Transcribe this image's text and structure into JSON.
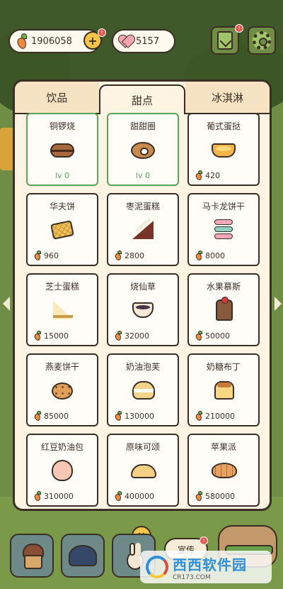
{
  "top_bar": {
    "carrots": "1906058",
    "carrot_badge": "!",
    "hearts": "5157",
    "ledger_badge": "!"
  },
  "tabs": [
    {
      "label": "饮品",
      "active": false
    },
    {
      "label": "甜点",
      "active": true
    },
    {
      "label": "冰淇淋",
      "active": false
    }
  ],
  "items": [
    {
      "name": "铜锣烧",
      "price": "",
      "level": "lv 0",
      "owned": true,
      "icon": "dorayaki-icon"
    },
    {
      "name": "甜甜圈",
      "price": "",
      "level": "lv 0",
      "owned": true,
      "icon": "donut-icon"
    },
    {
      "name": "葡式蛋挞",
      "price": "420",
      "level": "",
      "owned": false,
      "icon": "egg-tart-icon"
    },
    {
      "name": "华夫饼",
      "price": "960",
      "level": "",
      "owned": false,
      "icon": "waffle-icon"
    },
    {
      "name": "枣泥蛋糕",
      "price": "2800",
      "level": "",
      "owned": false,
      "icon": "date-cake-icon"
    },
    {
      "name": "马卡龙饼干",
      "price": "8000",
      "level": "",
      "owned": false,
      "icon": "macaron-icon"
    },
    {
      "name": "芝士蛋糕",
      "price": "15000",
      "level": "",
      "owned": false,
      "icon": "cheesecake-icon"
    },
    {
      "name": "烧仙草",
      "price": "32000",
      "level": "",
      "owned": false,
      "icon": "grass-jelly-icon"
    },
    {
      "name": "水果慕斯",
      "price": "50000",
      "level": "",
      "owned": false,
      "icon": "fruit-mousse-icon"
    },
    {
      "name": "燕麦饼干",
      "price": "85000",
      "level": "",
      "owned": false,
      "icon": "oat-cookie-icon"
    },
    {
      "name": "奶油泡芙",
      "price": "130000",
      "level": "",
      "owned": false,
      "icon": "cream-puff-icon"
    },
    {
      "name": "奶糖布丁",
      "price": "210000",
      "level": "",
      "owned": false,
      "icon": "pudding-icon"
    },
    {
      "name": "红豆奶油包",
      "price": "310000",
      "level": "",
      "owned": false,
      "icon": "red-bean-bun-icon"
    },
    {
      "name": "原味可颂",
      "price": "400000",
      "level": "",
      "owned": false,
      "icon": "croissant-icon"
    },
    {
      "name": "苹果派",
      "price": "580000",
      "level": "",
      "owned": false,
      "icon": "apple-pie-icon"
    }
  ],
  "bottom": {
    "close_label": "×",
    "promo_label": "宣传",
    "promo_badge": "!"
  },
  "watermark": {
    "main": "西西软件园",
    "sub": "CR173.COM"
  },
  "colors": {
    "panel_bg": "#fdf4e3",
    "outline": "#3b2f25",
    "owned_border": "#5aa55a",
    "accent_yellow": "#f5c54a"
  }
}
